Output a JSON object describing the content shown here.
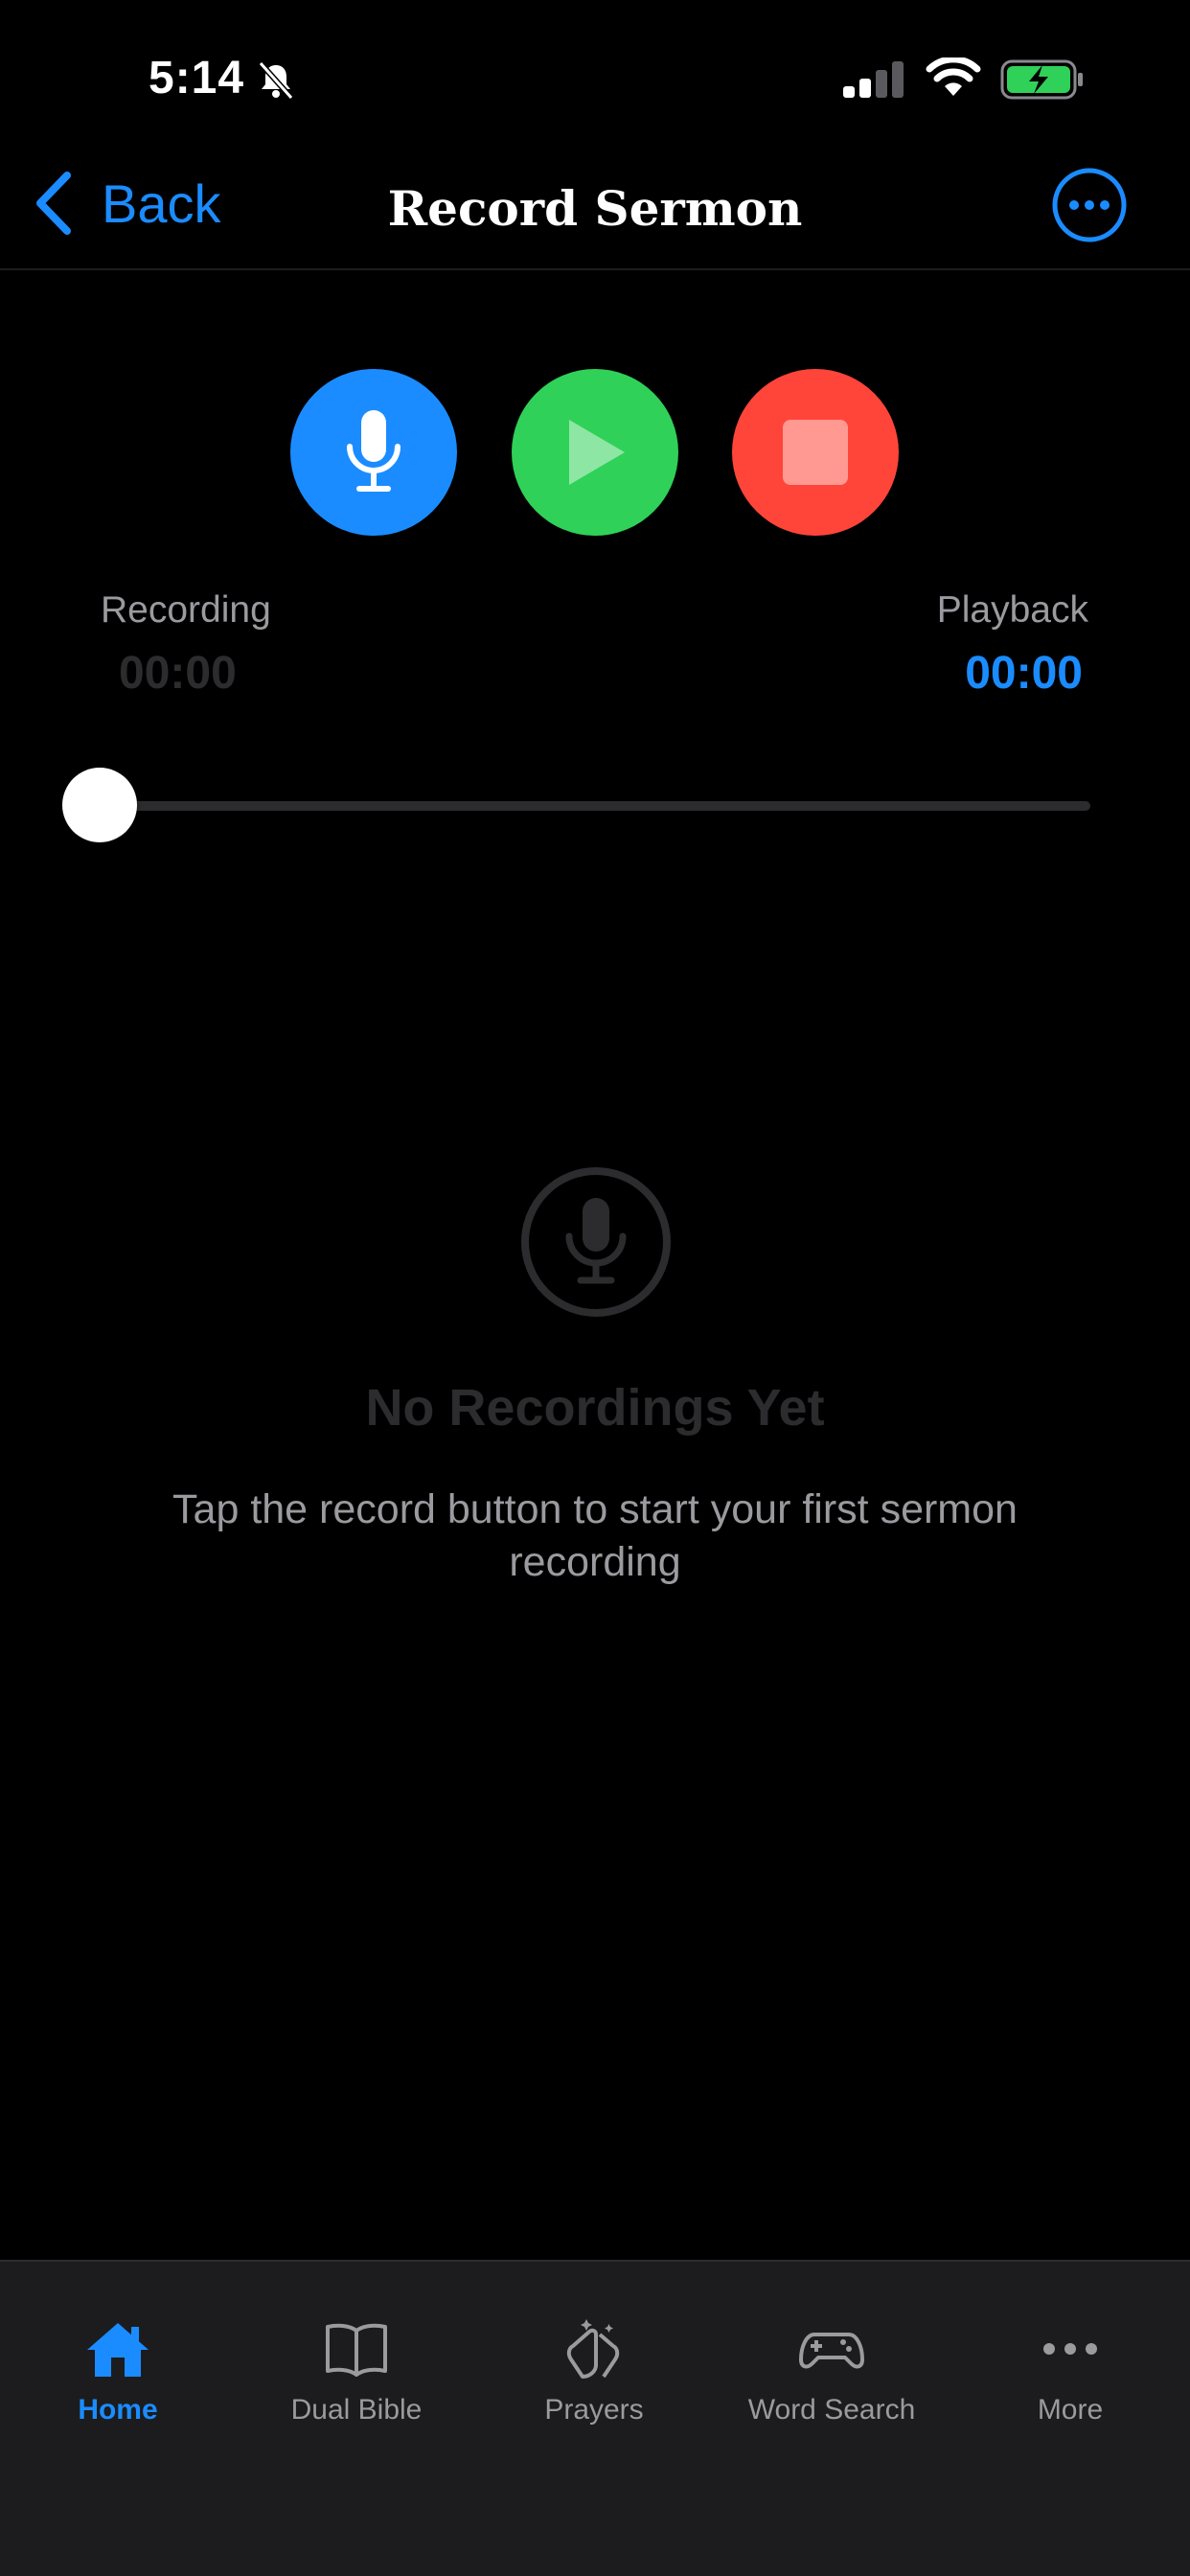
{
  "status_bar": {
    "time": "5:14"
  },
  "nav": {
    "back_label": "Back",
    "title": "Record Sermon"
  },
  "controls": {
    "recording_label": "Recording",
    "recording_time": "00:00",
    "playback_label": "Playback",
    "playback_time": "00:00",
    "progress_fraction": 0.0
  },
  "empty_state": {
    "title": "No Recordings Yet",
    "subtitle": "Tap the record button to start your first sermon recording"
  },
  "tab_bar": {
    "items": [
      {
        "label": "Home",
        "icon": "home-icon",
        "active": true
      },
      {
        "label": "Dual Bible",
        "icon": "book-icon",
        "active": false
      },
      {
        "label": "Prayers",
        "icon": "praying-hands-icon",
        "active": false
      },
      {
        "label": "Word Search",
        "icon": "gamepad-icon",
        "active": false
      },
      {
        "label": "More",
        "icon": "ellipsis-icon",
        "active": false
      }
    ]
  },
  "colors": {
    "accent": "#1a8cff",
    "record": "#1a8cff",
    "play": "#30d158",
    "stop": "#ff453a",
    "tab_bar_bg": "#1c1c1e"
  }
}
